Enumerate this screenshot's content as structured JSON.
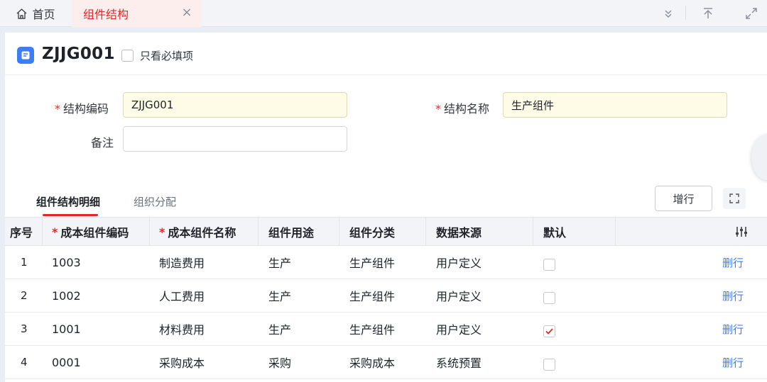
{
  "tabs": {
    "home_label": "首页",
    "active_label": "组件结构"
  },
  "header": {
    "doc_code": "ZJJG001",
    "only_required_label": "只看必填项"
  },
  "form": {
    "code_label": "结构编码",
    "code_value": "ZJJG001",
    "name_label": "结构名称",
    "name_value": "生产组件",
    "remark_label": "备注",
    "remark_value": ""
  },
  "detail_tabs": {
    "tab1": "组件结构明细",
    "tab2": "组织分配",
    "add_row_label": "增行"
  },
  "table": {
    "columns": [
      "序号",
      "成本组件编码",
      "成本组件名称",
      "组件用途",
      "组件分类",
      "数据来源",
      "默认"
    ],
    "delete_label": "删行",
    "rows": [
      {
        "seq": "1",
        "code": "1003",
        "name": "制造费用",
        "usage": "生产",
        "category": "生产组件",
        "source": "用户定义",
        "default": false
      },
      {
        "seq": "2",
        "code": "1002",
        "name": "人工费用",
        "usage": "生产",
        "category": "生产组件",
        "source": "用户定义",
        "default": false
      },
      {
        "seq": "3",
        "code": "1001",
        "name": "材料费用",
        "usage": "生产",
        "category": "生产组件",
        "source": "用户定义",
        "default": true
      },
      {
        "seq": "4",
        "code": "0001",
        "name": "采购成本",
        "usage": "采购",
        "category": "采购成本",
        "source": "系统预置",
        "default": false
      }
    ]
  },
  "colors": {
    "accent_red": "#e02a2a",
    "link_blue": "#3d7df5",
    "required_field_bg": "#fefbe6"
  }
}
